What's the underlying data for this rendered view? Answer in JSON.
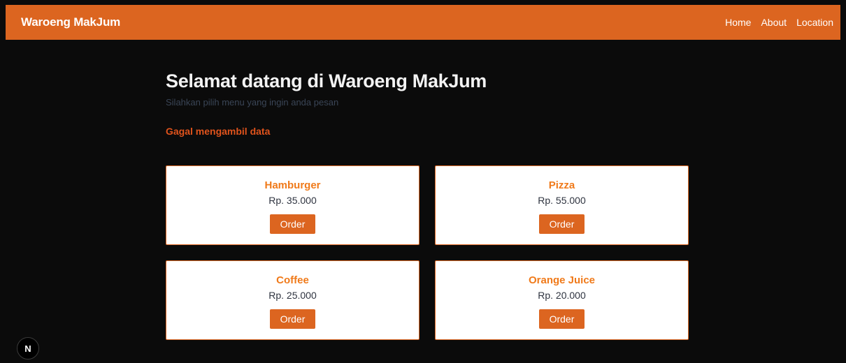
{
  "navbar": {
    "brand": "Waroeng MakJum",
    "links": [
      {
        "label": "Home"
      },
      {
        "label": "About"
      },
      {
        "label": "Location"
      }
    ]
  },
  "hero": {
    "title": "Selamat datang di Waroeng MakJum",
    "subtitle": "Silahkan pilih menu yang ingin anda pesan"
  },
  "error_message": "Gagal mengambil data",
  "menu": [
    {
      "name": "Hamburger",
      "price": "Rp. 35.000",
      "button_label": "Order"
    },
    {
      "name": "Pizza",
      "price": "Rp. 55.000",
      "button_label": "Order"
    },
    {
      "name": "Coffee",
      "price": "Rp. 25.000",
      "button_label": "Order"
    },
    {
      "name": "Orange Juice",
      "price": "Rp. 20.000",
      "button_label": "Order"
    }
  ],
  "dev_badge": {
    "label": "N",
    "icon": "nextjs-icon"
  },
  "colors": {
    "accent": "#dc6520",
    "background": "#0b0b0b",
    "card_title": "#f07a1a",
    "error": "#e0531c"
  }
}
